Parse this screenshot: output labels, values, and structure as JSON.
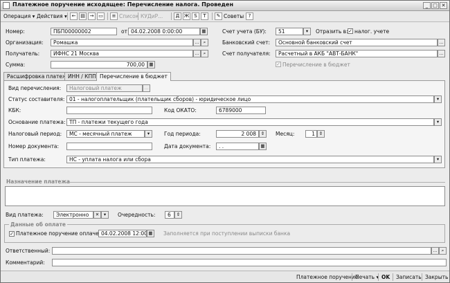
{
  "window": {
    "title": "Платежное поручение исходящее: Перечисление налога. Проведен"
  },
  "toolbar": {
    "operation": "Операция ▾",
    "actions": "Действия ▾",
    "list": "Список",
    "kudir": "КУДиР...",
    "tips": "Советы",
    "help": "?"
  },
  "header": {
    "number_label": "Номер:",
    "number_value": "ПБП00000002",
    "from_label": "от",
    "date_value": "04.02.2008  0:00:00",
    "org_label": "Организация:",
    "org_value": "Ромашка",
    "recipient_label": "Получатель:",
    "recipient_value": "ИФНС 21 Москва",
    "sum_label": "Сумма:",
    "sum_value": "700,00",
    "account_label": "Счет учета (БУ):",
    "account_value": "51",
    "reflect_label": "Отразить в:",
    "tax_accounting_label": "налог. учете",
    "bank_account_label": "Банковский счет:",
    "bank_account_value": "Основной банковский счет",
    "recipient_account_label": "Счет получателя:",
    "recipient_account_value": "Расчетный в АКБ \"АВТ-БАНК\"",
    "budget_transfer_label": "Перечисление в бюджет"
  },
  "tabs": [
    "Расшифровка платежа",
    "ИНН / КПП",
    "Перечисление в бюджет"
  ],
  "budget": {
    "transfer_type_label": "Вид перечисления:",
    "transfer_type_value": "Налоговый платеж",
    "status_label": "Статус составителя:",
    "status_value": "01 - налогоплательщик (плательщик сборов) - юридическое лицо",
    "kbk_label": "КБК:",
    "kbk_value": "",
    "okato_label": "Код ОКАТО:",
    "okato_value": "6789000",
    "basis_label": "Основание платежа:",
    "basis_value": "ТП - платежи текущего года",
    "period_label": "Налоговый период:",
    "period_value": "МС - месячный платеж",
    "year_label": "Год периода:",
    "year_value": "2 008",
    "month_label": "Месяц:",
    "month_value": "1",
    "doc_number_label": "Номер документа:",
    "doc_number_value": "",
    "doc_date_label": "Дата документа:",
    "doc_date_value": " .  .",
    "payment_type_label": "Тип платежа:",
    "payment_type_value": "НС - уплата налога или сбора"
  },
  "purpose": {
    "title": "Назначение платежа",
    "text": ""
  },
  "payment": {
    "kind_label": "Вид платежа:",
    "kind_value": "Электронно",
    "priority_label": "Очередность:",
    "priority_value": "6"
  },
  "paydata": {
    "title": "Данные об оплате",
    "paid_label": "Платежное поручение оплачено:",
    "paid_value": "04.02.2008 12:00:01",
    "hint": "Заполняется при поступлении выписки банка"
  },
  "footer": {
    "responsible_label": "Ответственный:",
    "responsible_value": "",
    "comment_label": "Комментарий:",
    "comment_value": ""
  },
  "statusbar": {
    "doc": "Платежное поручение",
    "print": "Печать ▾",
    "ok": "OK",
    "save": "Записать",
    "close": "Закрыть"
  }
}
